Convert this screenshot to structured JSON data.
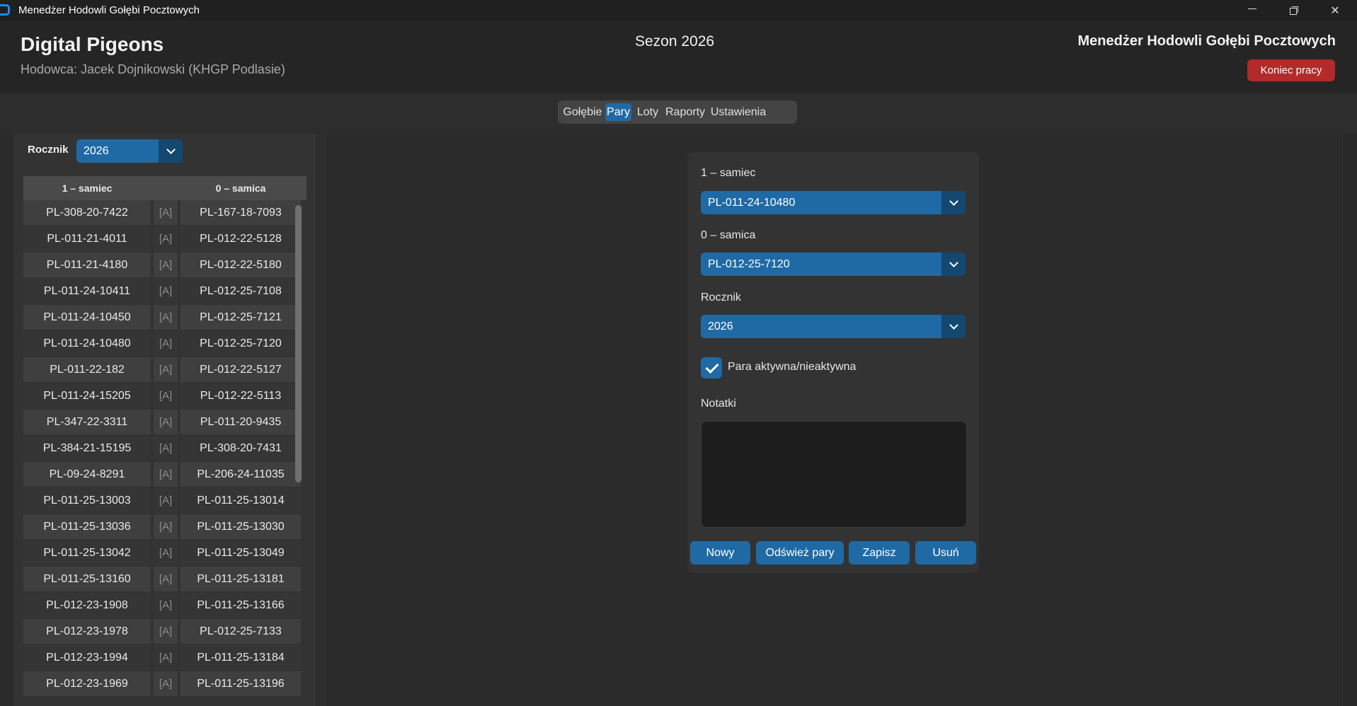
{
  "window": {
    "title": "Menedżer Hodowli Gołębi Pocztowych"
  },
  "header": {
    "brand": "Digital Pigeons",
    "breeder": "Hodowca: Jacek Dojnikowski (KHGP Podlasie)",
    "season": "Sezon 2026",
    "app_name": "Menedżer Hodowli Gołębi Pocztowych",
    "logout_label": "Koniec pracy"
  },
  "nav": {
    "tabs": [
      "Gołębie",
      "Pary",
      "Loty",
      "Raporty",
      "Ustawienia"
    ],
    "active_tab": "Pary"
  },
  "left": {
    "rocznik_label": "Rocznik",
    "rocznik_value": "2026",
    "columns": [
      "1 – samiec",
      "0 – samica"
    ],
    "rows": [
      {
        "male": "PL-308-20-7422",
        "status": "[A]",
        "female": "PL-167-18-7093"
      },
      {
        "male": "PL-011-21-4011",
        "status": "[A]",
        "female": "PL-012-22-5128"
      },
      {
        "male": "PL-011-21-4180",
        "status": "[A]",
        "female": "PL-012-22-5180"
      },
      {
        "male": "PL-011-24-10411",
        "status": "[A]",
        "female": "PL-012-25-7108"
      },
      {
        "male": "PL-011-24-10450",
        "status": "[A]",
        "female": "PL-012-25-7121"
      },
      {
        "male": "PL-011-24-10480",
        "status": "[A]",
        "female": "PL-012-25-7120"
      },
      {
        "male": "PL-011-22-182",
        "status": "[A]",
        "female": "PL-012-22-5127"
      },
      {
        "male": "PL-011-24-15205",
        "status": "[A]",
        "female": "PL-012-22-5113"
      },
      {
        "male": "PL-347-22-3311",
        "status": "[A]",
        "female": "PL-011-20-9435"
      },
      {
        "male": "PL-384-21-15195",
        "status": "[A]",
        "female": "PL-308-20-7431"
      },
      {
        "male": "PL-09-24-8291",
        "status": "[A]",
        "female": "PL-206-24-11035"
      },
      {
        "male": "PL-011-25-13003",
        "status": "[A]",
        "female": "PL-011-25-13014"
      },
      {
        "male": "PL-011-25-13036",
        "status": "[A]",
        "female": "PL-011-25-13030"
      },
      {
        "male": "PL-011-25-13042",
        "status": "[A]",
        "female": "PL-011-25-13049"
      },
      {
        "male": "PL-011-25-13160",
        "status": "[A]",
        "female": "PL-011-25-13181"
      },
      {
        "male": "PL-012-23-1908",
        "status": "[A]",
        "female": "PL-011-25-13166"
      },
      {
        "male": "PL-012-23-1978",
        "status": "[A]",
        "female": "PL-012-25-7133"
      },
      {
        "male": "PL-012-23-1994",
        "status": "[A]",
        "female": "PL-011-25-13184"
      },
      {
        "male": "PL-012-23-1969",
        "status": "[A]",
        "female": "PL-011-25-13196"
      }
    ]
  },
  "form": {
    "male_label": "1 – samiec",
    "male_value": "PL-011-24-10480",
    "female_label": "0 – samica",
    "female_value": "PL-012-25-7120",
    "rocznik_label": "Rocznik",
    "rocznik_value": "2026",
    "active_checkbox_label": "Para aktywna/nieaktywna",
    "active_checked": true,
    "notes_label": "Notatki",
    "notes_value": "",
    "buttons": {
      "new": "Nowy",
      "refresh": "Odśwież pary",
      "save": "Zapisz",
      "delete": "Usuń"
    }
  },
  "colors": {
    "accent": "#1f6aa5",
    "accent_dark": "#144870",
    "danger": "#b22a2a",
    "background": "#2b2b2b"
  }
}
